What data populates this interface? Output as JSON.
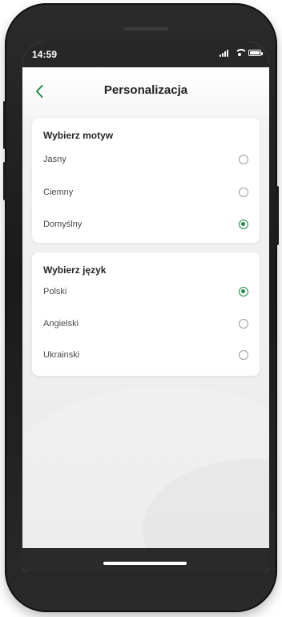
{
  "status_bar": {
    "time": "14:59"
  },
  "header": {
    "title": "Personalizacja",
    "back_icon": "chevron-left-icon",
    "accent_color": "#1f8a45"
  },
  "theme_section": {
    "title": "Wybierz motyw",
    "options": [
      {
        "label": "Jasny",
        "selected": false
      },
      {
        "label": "Ciemny",
        "selected": false
      },
      {
        "label": "Domyślny",
        "selected": true
      }
    ]
  },
  "language_section": {
    "title": "Wybierz język",
    "options": [
      {
        "label": "Polski",
        "selected": true
      },
      {
        "label": "Angielski",
        "selected": false
      },
      {
        "label": "Ukrainski",
        "selected": false
      }
    ]
  }
}
